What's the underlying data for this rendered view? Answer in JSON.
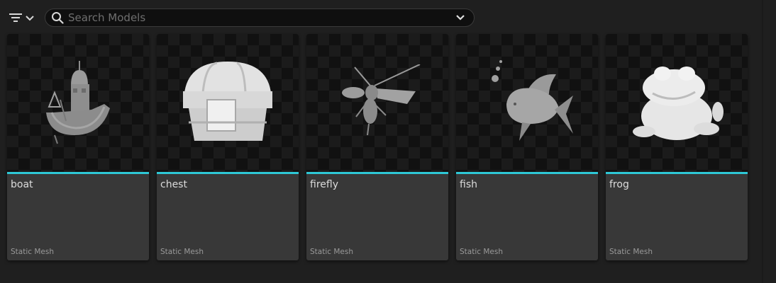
{
  "search": {
    "placeholder": "Search Models",
    "value": ""
  },
  "toolbar": {
    "filter_icon": "filter-icon",
    "filter_dropdown_icon": "chevron-down-icon",
    "search_icon": "search-icon",
    "search_dropdown_icon": "chevron-down-icon"
  },
  "colors": {
    "accent": "#2ec8d6",
    "card_bg": "#383838",
    "background": "#1f1f1f"
  },
  "assets": [
    {
      "name": "boat",
      "type": "Static Mesh",
      "icon": "boat-model-icon"
    },
    {
      "name": "chest",
      "type": "Static Mesh",
      "icon": "chest-model-icon"
    },
    {
      "name": "firefly",
      "type": "Static Mesh",
      "icon": "firefly-model-icon"
    },
    {
      "name": "fish",
      "type": "Static Mesh",
      "icon": "fish-model-icon"
    },
    {
      "name": "frog",
      "type": "Static Mesh",
      "icon": "frog-model-icon"
    }
  ]
}
